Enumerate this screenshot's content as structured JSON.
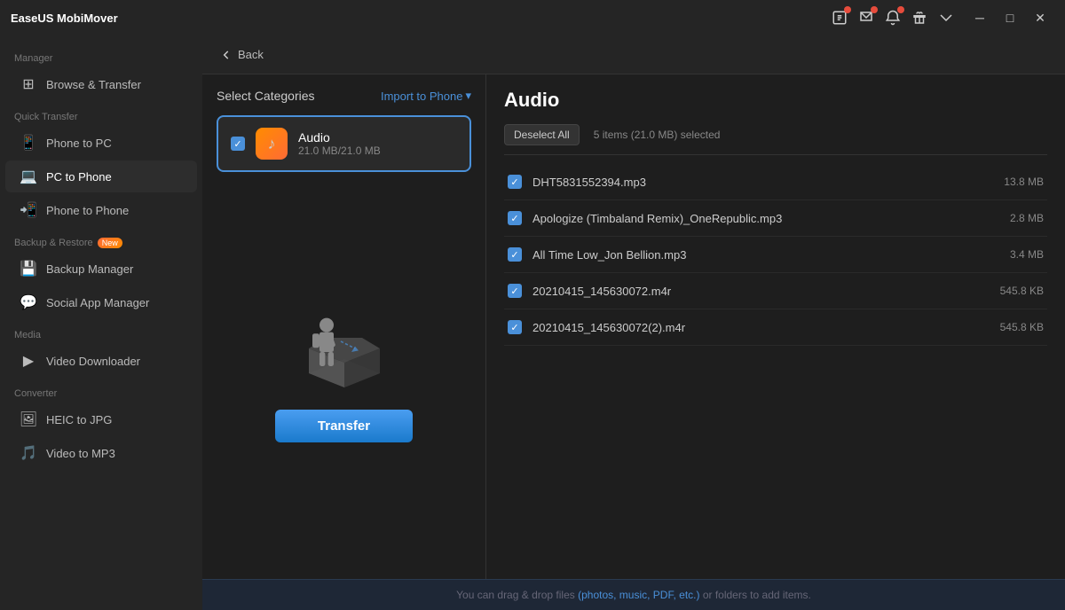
{
  "app": {
    "title": "EaseUS MobiMover"
  },
  "titlebar": {
    "icons": [
      {
        "name": "notification-icon",
        "has_badge": true
      },
      {
        "name": "message-icon",
        "has_badge": true
      },
      {
        "name": "bell-icon",
        "has_badge": true
      },
      {
        "name": "gift-icon",
        "has_badge": false
      },
      {
        "name": "dropdown-icon",
        "has_badge": false
      }
    ],
    "controls": [
      "minimize",
      "maximize",
      "close"
    ]
  },
  "sidebar": {
    "sections": [
      {
        "label": "Manager",
        "items": [
          {
            "id": "browse-transfer",
            "label": "Browse & Transfer",
            "icon": "⊞",
            "active": false
          }
        ]
      },
      {
        "label": "Quick Transfer",
        "items": [
          {
            "id": "phone-to-pc",
            "label": "Phone to PC",
            "icon": "📱",
            "active": false
          },
          {
            "id": "pc-to-phone",
            "label": "PC to Phone",
            "icon": "💻",
            "active": true
          },
          {
            "id": "phone-to-phone",
            "label": "Phone to Phone",
            "icon": "📲",
            "active": false
          }
        ]
      },
      {
        "label": "Backup & Restore",
        "items": [
          {
            "id": "backup-manager",
            "label": "Backup Manager",
            "icon": "💾",
            "active": false,
            "new": false
          },
          {
            "id": "social-app-manager",
            "label": "Social App Manager",
            "icon": "💬",
            "active": false,
            "new": false
          }
        ]
      },
      {
        "label": "Media",
        "items": [
          {
            "id": "video-downloader",
            "label": "Video Downloader",
            "icon": "▶",
            "active": false
          }
        ]
      },
      {
        "label": "Converter",
        "items": [
          {
            "id": "heic-to-jpg",
            "label": "HEIC to JPG",
            "icon": "🖼",
            "active": false
          },
          {
            "id": "video-to-mp3",
            "label": "Video to MP3",
            "icon": "🎵",
            "active": false
          }
        ]
      }
    ]
  },
  "back_button": "Back",
  "select_categories": {
    "title": "Select Categories",
    "import_button": "Import to Phone"
  },
  "category": {
    "name": "Audio",
    "size": "21.0 MB/21.0 MB",
    "checked": true
  },
  "transfer_button": "Transfer",
  "audio_panel": {
    "title": "Audio",
    "deselect_all": "Deselect All",
    "selection_info": "5 items (21.0 MB) selected",
    "files": [
      {
        "name": "DHT5831552394.mp3",
        "size": "13.8 MB",
        "checked": true
      },
      {
        "name": "Apologize (Timbaland Remix)_OneRepublic.mp3",
        "size": "2.8 MB",
        "checked": true
      },
      {
        "name": "All Time Low_Jon Bellion.mp3",
        "size": "3.4 MB",
        "checked": true
      },
      {
        "name": "20210415_145630072.m4r",
        "size": "545.8 KB",
        "checked": true
      },
      {
        "name": "20210415_145630072(2).m4r",
        "size": "545.8 KB",
        "checked": true
      }
    ]
  },
  "bottom_bar": {
    "text_before": "You can drag & drop files ",
    "highlight": "(photos, music, PDF, etc.)",
    "text_after": " or folders to add items."
  }
}
